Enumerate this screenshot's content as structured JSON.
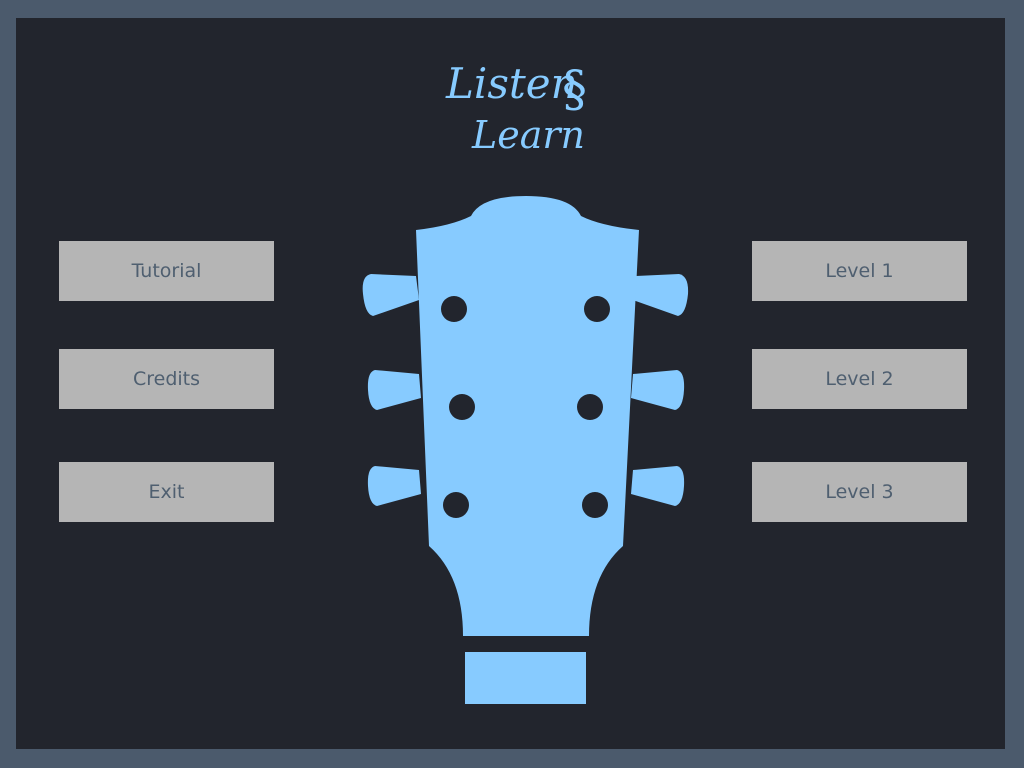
{
  "logo": {
    "line1": "Listen",
    "line2": "Learn",
    "color": "#87cbff"
  },
  "left_menu": [
    {
      "label": "Tutorial"
    },
    {
      "label": "Credits"
    },
    {
      "label": "Exit"
    }
  ],
  "right_menu": [
    {
      "label": "Level 1"
    },
    {
      "label": "Level 2"
    },
    {
      "label": "Level 3"
    }
  ],
  "colors": {
    "background": "#22252d",
    "border": "#4b5a6c",
    "guitar": "#87cbff",
    "button": "#b5b5b5",
    "button_text": "#4f5f70"
  }
}
